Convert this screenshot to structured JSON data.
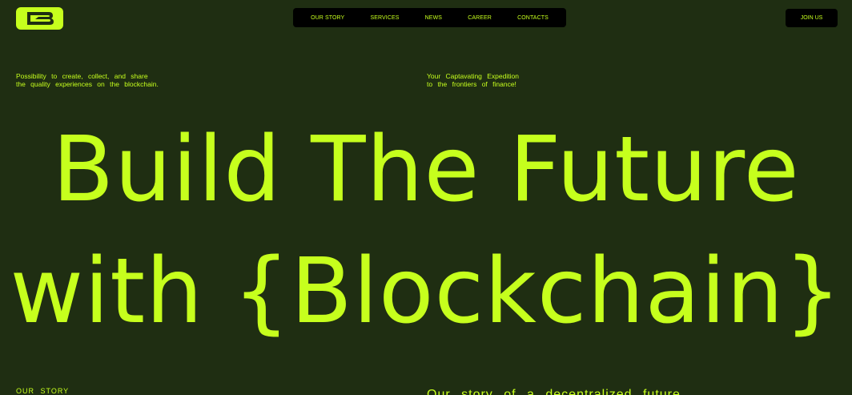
{
  "logo": {
    "icon": "logo-b-icon"
  },
  "nav": {
    "items": [
      {
        "label": "OUR STORY"
      },
      {
        "label": "SERVICES"
      },
      {
        "label": "NEWS"
      },
      {
        "label": "CAREER"
      },
      {
        "label": "CONTACTS"
      }
    ]
  },
  "header": {
    "join_label": "JOIN US"
  },
  "taglines": {
    "left_line1": "Possibility to create, collect, and share",
    "left_line2": "the quality experiences on the blockchain.",
    "right_line1": "Your Captavating Expedition",
    "right_line2": "to the frontiers of finance!"
  },
  "hero": {
    "line1": "Build The Future",
    "line2": "with {Blockchain}"
  },
  "section": {
    "label": "OUR STORY",
    "heading": "Our story of a decentralized future"
  },
  "colors": {
    "background": "#1f2e12",
    "accent": "#c6ff1d",
    "nav_bg": "#000000"
  }
}
